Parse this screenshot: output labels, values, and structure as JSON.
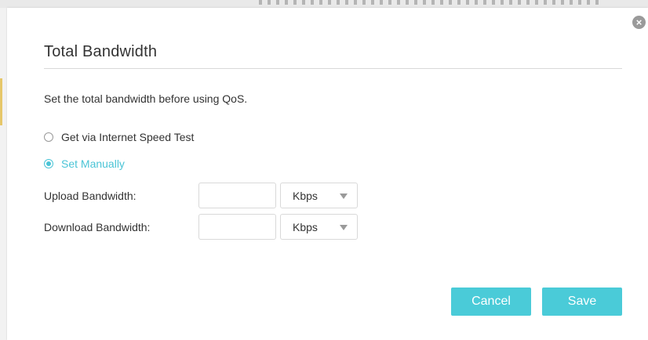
{
  "dialog": {
    "title": "Total Bandwidth",
    "close_icon": "close-circle-icon",
    "description": "Set the total bandwidth before using QoS.",
    "options": [
      {
        "label": "Get via Internet Speed Test",
        "selected": false
      },
      {
        "label": "Set Manually",
        "selected": true
      }
    ],
    "fields": {
      "upload": {
        "label": "Upload Bandwidth:",
        "value": "",
        "unit": "Kbps"
      },
      "download": {
        "label": "Download Bandwidth:",
        "value": "",
        "unit": "Kbps"
      }
    },
    "buttons": {
      "cancel": "Cancel",
      "save": "Save"
    },
    "colors": {
      "accent": "#4acbd8",
      "text": "#333333"
    }
  }
}
